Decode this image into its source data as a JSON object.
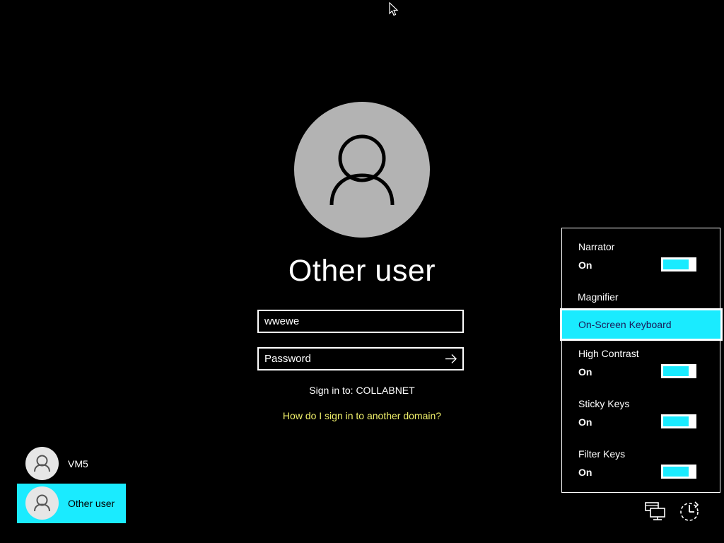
{
  "login": {
    "user_title": "Other user",
    "username_value": "wwewe",
    "password_placeholder": "Password",
    "sign_in_to": "Sign in to: COLLABNET",
    "domain_link": "How do I sign in to another domain?"
  },
  "user_list": [
    {
      "label": "VM5",
      "selected": false
    },
    {
      "label": "Other user",
      "selected": true
    }
  ],
  "ease_of_access": {
    "items": [
      {
        "name": "Narrator",
        "state": "On",
        "has_toggle": true
      },
      {
        "name": "Magnifier",
        "has_toggle": false
      },
      {
        "name": "On-Screen Keyboard",
        "has_toggle": false,
        "highlighted": true
      },
      {
        "name": "High Contrast",
        "state": "On",
        "has_toggle": true
      },
      {
        "name": "Sticky Keys",
        "state": "On",
        "has_toggle": true
      },
      {
        "name": "Filter Keys",
        "state": "On",
        "has_toggle": true
      }
    ]
  },
  "corner_icons": [
    "network-icon",
    "ease-of-access-icon"
  ],
  "colors": {
    "background": "#000000",
    "accent": "#1aebff",
    "link": "#f0f06a",
    "avatar_large": "#b3b3b3",
    "avatar_small": "#e6e6e6"
  }
}
